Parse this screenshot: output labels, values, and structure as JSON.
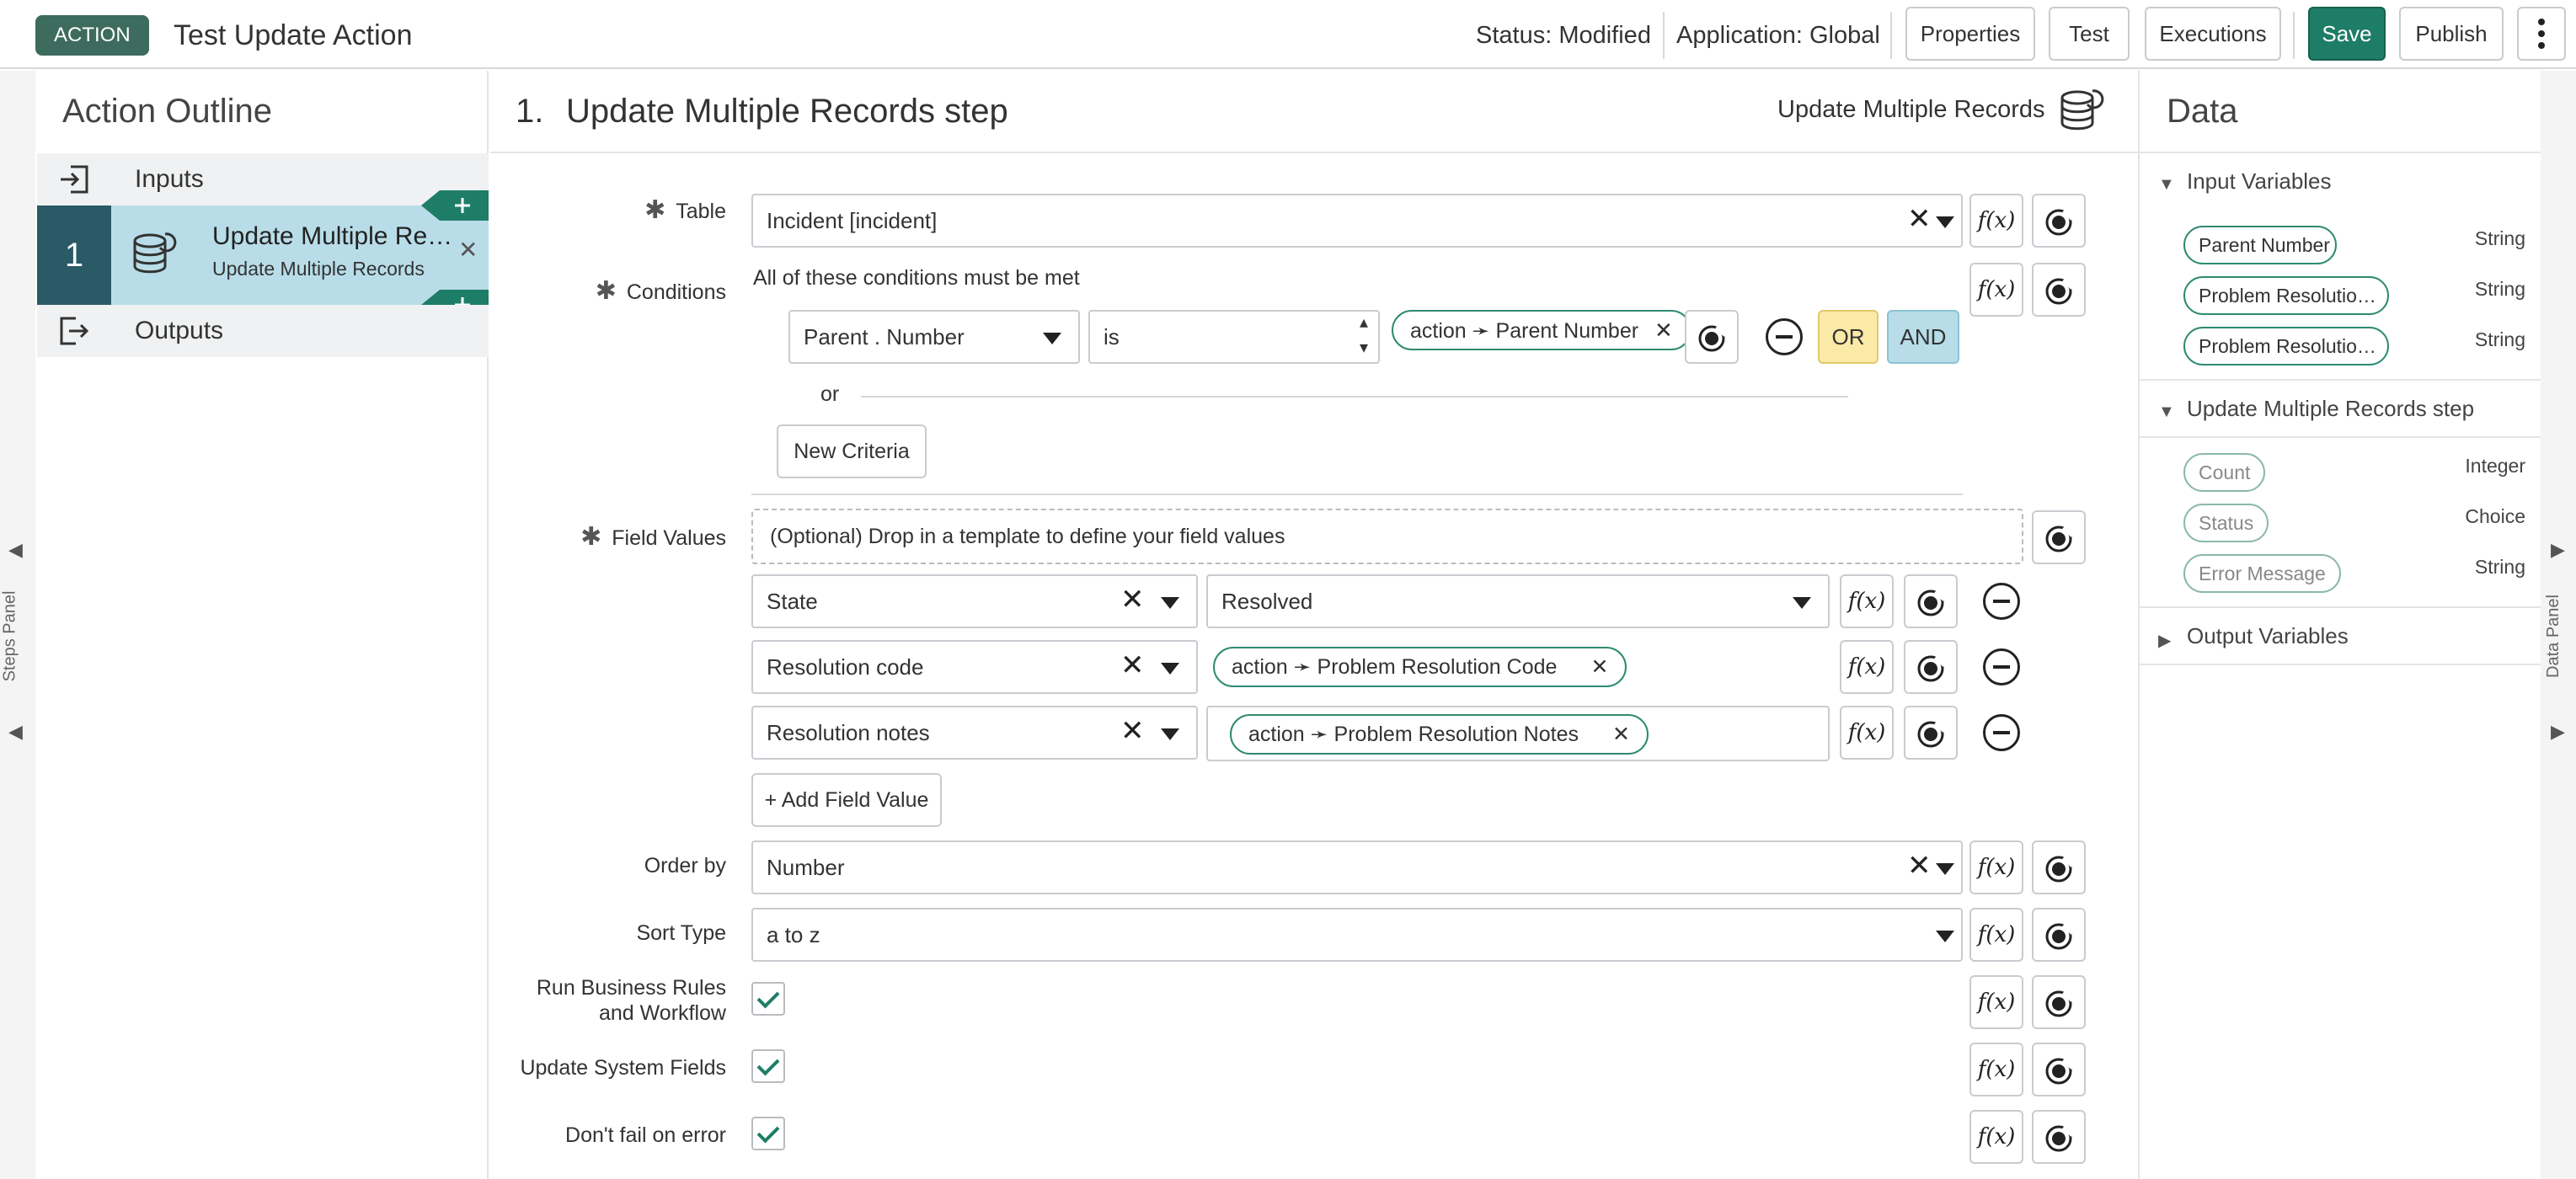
{
  "header": {
    "badge": "ACTION",
    "title": "Test Update Action",
    "status": "Status: Modified",
    "application": "Application: Global",
    "buttons": {
      "properties": "Properties",
      "test": "Test",
      "executions": "Executions",
      "save": "Save",
      "publish": "Publish"
    },
    "more_icon": "vertical-dots-icon"
  },
  "steps_panel": {
    "label": "Steps Panel"
  },
  "data_panel_edge": {
    "label": "Data Panel"
  },
  "outline": {
    "title": "Action Outline",
    "inputs": "Inputs",
    "step": {
      "number": "1",
      "title": "Update Multiple Re…",
      "subtitle": "Update Multiple Records"
    },
    "outputs": "Outputs",
    "add_symbol": "+",
    "remove_symbol": "✕"
  },
  "step": {
    "heading_number": "1.",
    "heading": "Update Multiple Records step",
    "type_label": "Update Multiple Records",
    "table": {
      "label": "Table",
      "value": "Incident [incident]"
    },
    "conditions": {
      "label": "Conditions",
      "caption": "All of these conditions must be met",
      "field": "Parent . Number",
      "operator": "is",
      "value_pill": "action ➛ Parent Number",
      "or_label": "OR",
      "and_label": "AND",
      "or_separator": "or",
      "new_criteria": "New Criteria"
    },
    "field_values": {
      "label": "Field Values",
      "template_placeholder": "(Optional) Drop in a template to define your field values",
      "rows": [
        {
          "field": "State",
          "value": "Resolved"
        },
        {
          "field": "Resolution code",
          "value_pill": "action ➛ Problem Resolution Code"
        },
        {
          "field": "Resolution notes",
          "value_pill": "action ➛ Problem Resolution Notes"
        }
      ],
      "add_button": "+ Add Field Value"
    },
    "order_by": {
      "label": "Order by",
      "value": "Number"
    },
    "sort_type": {
      "label": "Sort Type",
      "value": "a to z"
    },
    "run_business_rules": {
      "label_line1": "Run Business Rules",
      "label_line2": "and Workflow",
      "checked": true
    },
    "update_system_fields": {
      "label": "Update System Fields",
      "checked": true
    },
    "dont_fail": {
      "label": "Don't fail on error",
      "checked": true
    },
    "fx_label": "f(x)"
  },
  "data": {
    "title": "Data",
    "input_variables": {
      "title": "Input Variables",
      "items": [
        {
          "name": "Parent Number",
          "type": "String"
        },
        {
          "name": "Problem Resolutio…",
          "type": "String"
        },
        {
          "name": "Problem Resolutio…",
          "type": "String"
        }
      ]
    },
    "step_section": {
      "title": "Update Multiple Records step",
      "items": [
        {
          "name": "Count",
          "type": "Integer"
        },
        {
          "name": "Status",
          "type": "Choice"
        },
        {
          "name": "Error Message",
          "type": "String"
        }
      ]
    },
    "output_variables": {
      "title": "Output Variables"
    }
  },
  "colors": {
    "accent": "#1e7d67",
    "badge": "#3d6b5d",
    "selected_step": "#b8dde8",
    "or_button": "#fbe9a8",
    "and_button": "#b8dde8"
  }
}
